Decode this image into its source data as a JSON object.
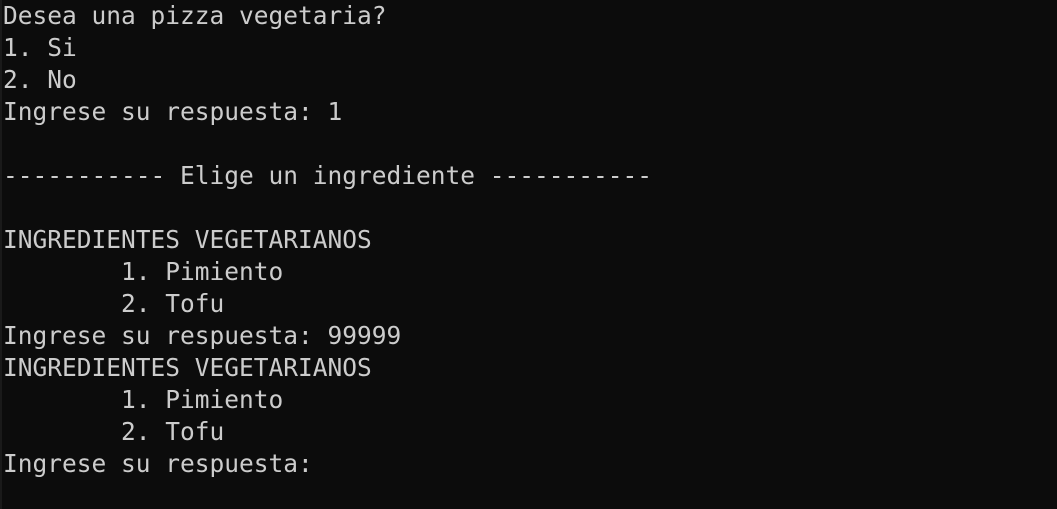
{
  "terminal": {
    "lines": [
      "Desea una pizza vegetaria?",
      "1. Si",
      "2. No",
      "Ingrese su respuesta: 1",
      "",
      "----------- Elige un ingrediente -----------",
      "",
      "INGREDIENTES VEGETARIANOS",
      "        1. Pimiento",
      "        2. Tofu",
      "Ingrese su respuesta: 99999",
      "INGREDIENTES VEGETARIANOS",
      "        1. Pimiento",
      "        2. Tofu",
      "Ingrese su respuesta:"
    ]
  },
  "colors": {
    "background": "#0c0c0c",
    "foreground": "#cccccc"
  }
}
